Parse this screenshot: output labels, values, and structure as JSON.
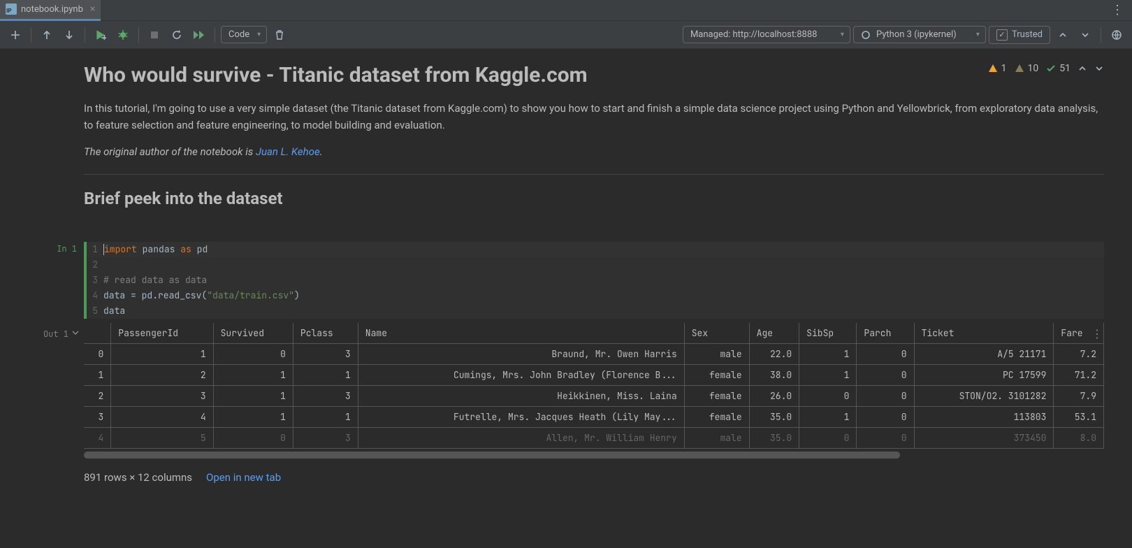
{
  "tab": {
    "filename": "notebook.ipynb"
  },
  "toolbar": {
    "cellType": "Code",
    "server": "Managed: http://localhost:8888",
    "kernel": "Python 3 (ipykernel)",
    "trusted": "Trusted"
  },
  "stats": {
    "warn1": "1",
    "warn2": "10",
    "ok": "51"
  },
  "markdown": {
    "h1": "Who would survive - Titanic dataset from Kaggle.com",
    "p1": "In this tutorial, I'm going to use a very simple dataset (the Titanic dataset from Kaggle.com) to show you how to start and finish a simple data science project using Python and Yellowbrick, from exploratory data analysis, to feature selection and feature engineering, to model building and evaluation.",
    "p2_prefix": "The original author of the notebook is ",
    "p2_link": "Juan L. Kehoe",
    "p2_suffix": ".",
    "h2": "Brief peek into the dataset"
  },
  "code": {
    "inLabel": "In 1",
    "lines": [
      {
        "n": "1",
        "tokens": [
          [
            "kw",
            "import"
          ],
          [
            "",
            " "
          ],
          [
            "",
            "pandas"
          ],
          [
            "",
            " "
          ],
          [
            "kw",
            "as"
          ],
          [
            "",
            " "
          ],
          [
            "",
            "pd"
          ]
        ]
      },
      {
        "n": "2",
        "tokens": [
          [
            "",
            ""
          ]
        ]
      },
      {
        "n": "3",
        "tokens": [
          [
            "comment",
            "# read data as data"
          ]
        ]
      },
      {
        "n": "4",
        "tokens": [
          [
            "",
            "data = pd.read_csv("
          ],
          [
            "str",
            "\"data/train.csv\""
          ],
          [
            "",
            ")"
          ]
        ]
      },
      {
        "n": "5",
        "tokens": [
          [
            "",
            "data"
          ]
        ]
      }
    ]
  },
  "output": {
    "outLabel": "Out 1",
    "columns": [
      "",
      "PassengerId",
      "Survived",
      "Pclass",
      "Name",
      "Sex",
      "Age",
      "SibSp",
      "Parch",
      "Ticket",
      "Fare"
    ],
    "rows": [
      [
        "0",
        "1",
        "0",
        "3",
        "Braund, Mr. Owen Harris",
        "male",
        "22.0",
        "1",
        "0",
        "A/5 21171",
        "7.2"
      ],
      [
        "1",
        "2",
        "1",
        "1",
        "Cumings, Mrs. John Bradley (Florence B...",
        "female",
        "38.0",
        "1",
        "0",
        "PC 17599",
        "71.2"
      ],
      [
        "2",
        "3",
        "1",
        "3",
        "Heikkinen, Miss. Laina",
        "female",
        "26.0",
        "0",
        "0",
        "STON/O2. 3101282",
        "7.9"
      ],
      [
        "3",
        "4",
        "1",
        "1",
        "Futrelle, Mrs. Jacques Heath (Lily May...",
        "female",
        "35.0",
        "1",
        "0",
        "113803",
        "53.1"
      ],
      [
        "4",
        "5",
        "0",
        "3",
        "Allen, Mr. William Henry",
        "male",
        "35.0",
        "0",
        "0",
        "373450",
        "8.0"
      ]
    ],
    "summary": "891 rows × 12 columns",
    "openLink": "Open in new tab"
  }
}
